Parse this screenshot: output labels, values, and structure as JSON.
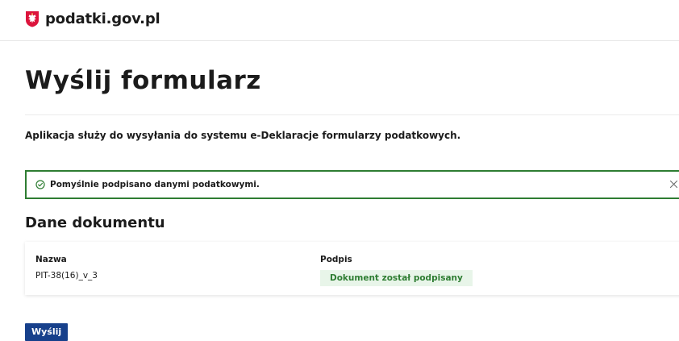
{
  "header": {
    "logo_icon": "polish-eagle-emblem-icon",
    "site_name": "podatki.gov.pl"
  },
  "page": {
    "title": "Wyślij formularz",
    "lead": "Aplikacja służy do wysyłania do systemu e-Deklaracje formularzy podatkowych."
  },
  "alert": {
    "icon": "check-circle-icon",
    "message": "Pomyślnie podpisano danymi podatkowymi.",
    "close_icon": "close-icon",
    "color": "#2e7d32"
  },
  "document": {
    "section_title": "Dane dokumentu",
    "name_label": "Nazwa",
    "name_value": "PIT-38(16)_v_3",
    "signature_label": "Podpis",
    "signature_status": "Dokument został podpisany",
    "status_color": "#2e7d32",
    "status_background": "#e8f5e9"
  },
  "actions": {
    "send_label": "Wyślij",
    "send_color": "#17408b"
  },
  "colors": {
    "accent": "#17408b",
    "success": "#2e7d32",
    "logo_red": "#dc143c"
  }
}
